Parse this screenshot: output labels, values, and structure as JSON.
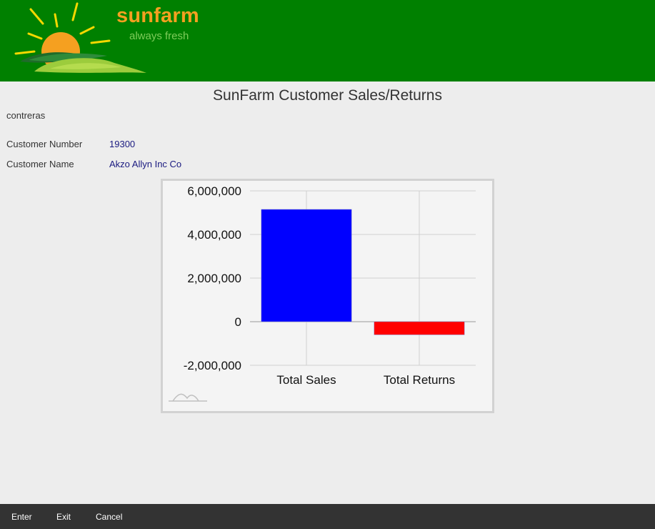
{
  "header": {
    "brand_name": "sunfarm",
    "tagline": "always fresh"
  },
  "page_title": "SunFarm Customer Sales/Returns",
  "user": "contreras",
  "customer": {
    "number_label": "Customer Number",
    "number_value": "19300",
    "name_label": "Customer Name",
    "name_value": "Akzo Allyn Inc Co"
  },
  "chart_data": {
    "type": "bar",
    "categories": [
      "Total Sales",
      "Total Returns"
    ],
    "values": [
      5150000,
      -600000
    ],
    "colors": [
      "#0000ff",
      "#ff0000"
    ],
    "ylim": [
      -2000000,
      6000000
    ],
    "yticks": [
      6000000,
      4000000,
      2000000,
      0,
      -2000000
    ],
    "ytick_labels": [
      "6,000,000",
      "4,000,000",
      "2,000,000",
      "0",
      "-2,000,000"
    ],
    "grid": true
  },
  "footer": {
    "enter_label": "Enter",
    "exit_label": "Exit",
    "cancel_label": "Cancel"
  },
  "colors": {
    "header_bg": "#008000",
    "brand": "#f5a020",
    "footer_bg": "#333333"
  }
}
